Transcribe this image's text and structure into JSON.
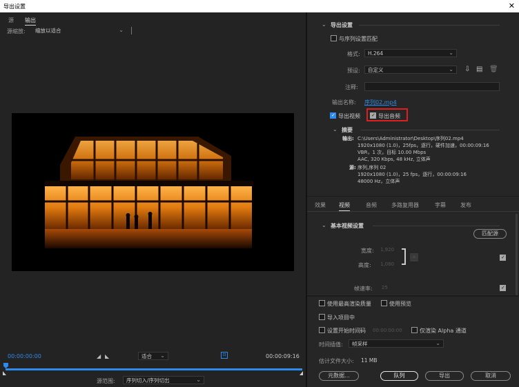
{
  "window": {
    "title": "导出设置",
    "close": "✕"
  },
  "left": {
    "tabs": [
      "源",
      "输出"
    ],
    "source_scaling_label": "源缩放:",
    "source_scaling_value": "缩放以适合",
    "timecode_start": "00:00:00:00",
    "timecode_end": "00:00:09:16",
    "fit_value": "适合",
    "source_range_label": "源范围:",
    "source_range_value": "序列切入/序列切出"
  },
  "export": {
    "section_title": "导出设置",
    "match_sequence": "与序列设置匹配",
    "format_label": "格式:",
    "format_value": "H.264",
    "preset_label": "预设:",
    "preset_value": "自定义",
    "comments_label": "注释:",
    "comments_value": "",
    "output_name_label": "输出名称:",
    "output_name_value": "序列02.mp4",
    "export_video": "导出视频",
    "export_audio": "导出音频",
    "summary_title": "摘要",
    "output_label": "输出:",
    "output_lines": [
      "C:\\Users\\Administrator\\Desktop\\序列02.mp4",
      "1920x1080 (1.0)，25fps，逐行，硬件加速，00:00:09:16",
      "VBR，1 次，目标 10.00 Mbps",
      "AAC, 320 Kbps, 48 kHz, 立体声"
    ],
    "source_label": "源:",
    "source_lines": [
      "序列,序列 02",
      "1920x1080 (1.0)，25 fps，逐行，00:00:09:16",
      "48000 Hz，立体声"
    ]
  },
  "settings_tabs": [
    "效果",
    "视频",
    "音频",
    "多路复用器",
    "字幕",
    "发布"
  ],
  "active_settings_tab": "视频",
  "basic_video": {
    "title": "基本视频设置",
    "match_source": "匹配源",
    "width_label": "宽度:",
    "width_value": "1,920",
    "height_label": "高度:",
    "height_value": "1,080",
    "frame_rate_label": "帧速率:",
    "frame_rate_value": "25"
  },
  "bottom": {
    "max_render_quality": "使用最高渲染质量",
    "use_previews": "使用预览",
    "import_into_project": "导入项目中",
    "set_start_timecode": "设置开始时间码",
    "start_timecode_value": "00:00:00:00",
    "render_alpha_only": "仅渲染 Alpha 通道",
    "time_interpolation_label": "时间插值:",
    "time_interpolation_value": "帧采样",
    "estimated_size_label": "估计文件大小:",
    "estimated_size_value": "11 MB",
    "metadata_button": "元数据...",
    "queue_button": "队列",
    "export_button": "导出",
    "cancel_button": "取消"
  },
  "colors": {
    "accent": "#2d8ceb",
    "highlight_box": "#e02020",
    "background": "#232323"
  }
}
